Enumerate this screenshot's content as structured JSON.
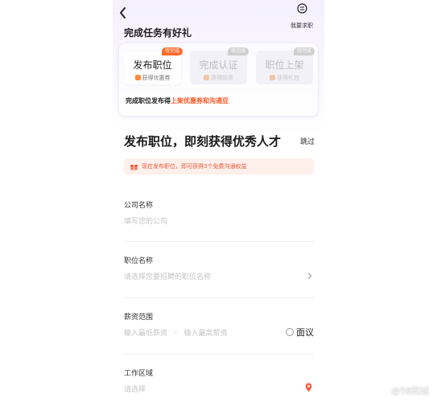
{
  "header": {
    "seek_job_label": "我要求职"
  },
  "banner": {
    "title": "完成任务有好礼",
    "tasks": [
      {
        "name": "发布职位",
        "reward": "获得优惠券",
        "status": "待完成",
        "state": "active"
      },
      {
        "name": "完成认证",
        "reward": "获得勋章",
        "status": "待完成",
        "state": "inactive"
      },
      {
        "name": "职位上架",
        "reward": "获得礼包",
        "status": "待完成",
        "state": "inactive"
      }
    ],
    "desc_prefix": "完成职位发布得",
    "desc_highlight": "上架优惠券和沟通豆"
  },
  "main": {
    "headline": "发布职位，即刻获得优秀人才",
    "skip_label": "跳过",
    "notice": "现在发布职位，即可获得3个免费沟通权益"
  },
  "form": {
    "company": {
      "label": "公司名称",
      "placeholder": "填写您的公司"
    },
    "position": {
      "label": "职位名称",
      "placeholder": "请选择您要招聘的职位名称"
    },
    "salary": {
      "label": "薪资范围",
      "min_placeholder": "输入最低薪资",
      "separator": "–",
      "max_placeholder": "输入最高薪资",
      "negotiable_label": "面议"
    },
    "area": {
      "label": "工作区域",
      "placeholder": "请选择"
    }
  },
  "watermark": "@58同城",
  "colors": {
    "accent": "#ff5722",
    "badge": "#ff6a2b",
    "notice_bg": "#fff0ec",
    "pin": "#ff5a3c"
  }
}
